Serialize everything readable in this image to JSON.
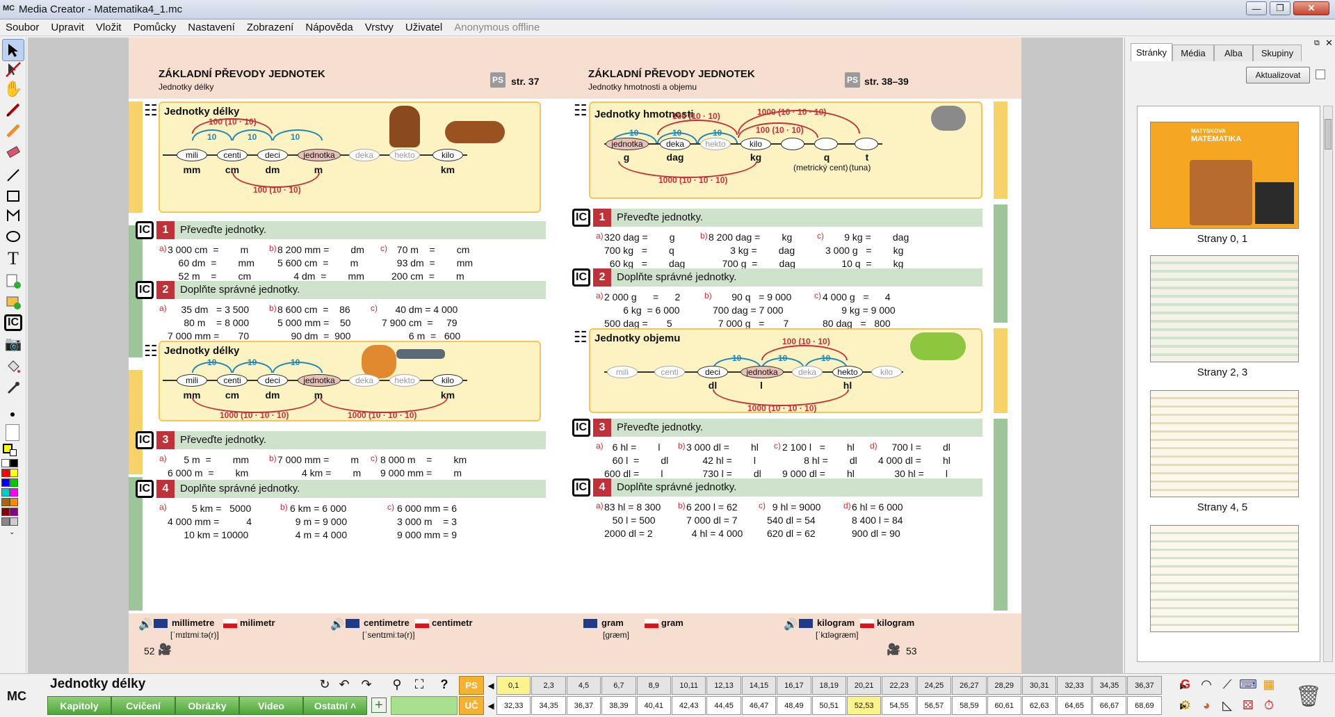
{
  "window": {
    "logo": "MC",
    "title": "Media Creator - Matematika4_1.mc",
    "minimize": "—",
    "maximize": "❐",
    "close": "✕"
  },
  "menu": [
    "Soubor",
    "Upravit",
    "Vložit",
    "Pomůcky",
    "Nastavení",
    "Zobrazení",
    "Nápověda",
    "Vrstvy",
    "Uživatel"
  ],
  "menu_status": "Anonymous offline",
  "left_page": {
    "title": "ZÁKLADNÍ PŘEVODY JEDNOTEK",
    "subtitle": "Jednotky délky",
    "ps": "PS",
    "str": "str. 37",
    "box1_title": "Jednotky délky",
    "box2_title": "Jednotky délky",
    "scale_nodes": [
      "mili",
      "centi",
      "deci",
      "jednotka",
      "deka",
      "hekto",
      "kilo"
    ],
    "scale_units": [
      "mm",
      "cm",
      "dm",
      "m",
      "km"
    ],
    "arc_10": "10",
    "arc_100": "100 (10 · 10)",
    "arc_1000": "1000 (10 · 10 · 10)",
    "ex1_title": "Převeďte jednotky.",
    "ex1_a": "3 000 cm  =        m\n    60 dm  =        mm\n    52 m    =        cm",
    "ex1_b": "8 200 mm =        dm\n5 600 cm  =        m\n      4 dm  =        mm",
    "ex1_c": "  70 m    =        cm\n  93 dm  =        mm\n200 cm  =        m",
    "ex2_title": "Doplňte správné jednotky.",
    "ex2_a": "     35 dm   = 3 500\n      80 m    = 8 000\n7 000 mm =       70",
    "ex2_b": "8 600 cm  =    86\n5 000 mm =    50\n     90 dm  =  900",
    "ex2_c": "     40 dm = 4 000\n7 900 cm  =     79\n          6 m  =   600",
    "ex3_title": "Převeďte jednotky.",
    "ex3_a": "      5 m  =        mm\n6 000 m  =        km",
    "ex3_b": "7 000 mm =        m\n         4 km =        m",
    "ex3_c": "8 000 m    =        km\n9 000 mm =        m",
    "ex4_title": "Doplňte správné jednotky.",
    "ex4_a": "         5 km =   5000\n4 000 mm =          4\n      10 km = 10000",
    "ex4_b": "6 km = 6 000\n  9 m = 9 000\n  4 m = 4 000",
    "ex4_c": "6 000 mm = 6\n3 000 m    = 3\n9 000 mm = 9",
    "foot_en": "millimetre",
    "foot_cz": "milimetr",
    "foot_ipa": "[ˈmɪlɪmiːtə(r)]",
    "foot_en2": "centimetre",
    "foot_cz2": "centimetr",
    "foot_ipa2": "[ˈsentɪmiːtə(r)]",
    "page_no": "52"
  },
  "right_page": {
    "title": "ZÁKLADNÍ PŘEVODY JEDNOTEK",
    "subtitle": "Jednotky hmotnosti a objemu",
    "ps": "PS",
    "str": "str. 38–39",
    "box1_title": "Jednotky hmotnosti",
    "mass_nodes": [
      "jednotka",
      "deka",
      "hekto",
      "kilo",
      "",
      "",
      ""
    ],
    "mass_units": [
      "g",
      "dag",
      "kg",
      "q",
      "t"
    ],
    "mass_notes": [
      "(metrický cent)",
      "(tuna)"
    ],
    "arc_10": "10",
    "arc_100": "100 (10 · 10)",
    "arc_1000": "1000 (10 · 10 · 10)",
    "box2_title": "Jednotky objemu",
    "vol_nodes": [
      "mili",
      "centi",
      "deci",
      "jednotka",
      "deka",
      "hekto",
      "kilo"
    ],
    "vol_units": [
      "dl",
      "l",
      "hl"
    ],
    "ex1_title": "Převeďte jednotky.",
    "ex1_a": "320 dag =        g\n700 kg   =        q\n  60 kg   =        dag",
    "ex1_b": "8 200 dag =        kg\n        3 kg =        dag\n     700 g  =        dag",
    "ex1_c": "       9 kg =        dag\n3 000 g   =        kg\n      10 q  =        kg",
    "ex2_title": "Doplňte správné jednotky.",
    "ex2_a": "2 000 g      =      2\n       6 kg  = 6 000\n500 dag =       5",
    "ex2_b": "       90 q   = 9 000\n700 dag = 7 000\n  7 000 g   =       7",
    "ex2_c": "4 000 g   =      4\n       9 kg = 9 000\n80 dag   =   800",
    "ex3_title": "Převeďte jednotky.",
    "ex3_a": "   6 hl =        l\n   60 l  =        dl\n600 dl =        l",
    "ex3_b": "3 000 dl =        hl\n      42 hl =        l\n      730 l =        dl",
    "ex3_c": "2 100 l   =        hl\n        8 hl =        dl\n9 000 dl =        hl",
    "ex3_d": "     700 l =        dl\n4 000 dl =        hl\n      30 hl =        l",
    "ex4_title": "Doplňte správné jednotky.",
    "ex4_a": "83 hl = 8 300\n   50 l = 500\n2000 dl = 2",
    "ex4_b": "6 200 l = 62\n7 000 dl = 7\n  4 hl = 4 000",
    "ex4_c": "  9 hl = 9000\n540 dl = 54\n620 dl = 62",
    "ex4_d": "6 hl = 6 000\n8 400 l = 84\n900 dl = 90",
    "foot_en": "gram",
    "foot_cz": "gram",
    "foot_ipa": "[græm]",
    "foot_en2": "kilogram",
    "foot_cz2": "kilogram",
    "foot_ipa2": "[ˈkɪləgræm]",
    "page_no": "53"
  },
  "ic_label": "IC",
  "exercise_numbers": [
    "1",
    "2",
    "3",
    "4"
  ],
  "exercise_letters": [
    "a)",
    "b)",
    "c)",
    "d)"
  ],
  "right_panel": {
    "tabs": [
      "Stránky",
      "Média",
      "Alba",
      "Skupiny"
    ],
    "refresh": "Aktualizovat",
    "thumbs": [
      "Strany 0, 1",
      "Strany 2, 3",
      "Strany 4, 5"
    ],
    "cover_brand": "MATYSKOVA",
    "cover_title": "MATEMATIKA"
  },
  "bottom": {
    "logo": "MC",
    "section_title": "Jednotky délky",
    "buttons": [
      "Kapitoly",
      "Cvičení",
      "Obrázky",
      "Video",
      "Ostatní ˄"
    ],
    "ps_label": "PS",
    "uc_label": "UČ",
    "ps_pages": [
      "0,1",
      "2,3",
      "4,5",
      "6,7",
      "8,9",
      "10,11",
      "12,13",
      "14,15",
      "16,17",
      "18,19",
      "20,21",
      "22,23",
      "24,25",
      "26,27",
      "28,29",
      "30,31",
      "32,33",
      "34,35",
      "36,37"
    ],
    "uc_pages": [
      "32,33",
      "34,35",
      "36,37",
      "38,39",
      "40,41",
      "42,43",
      "44,45",
      "46,47",
      "48,49",
      "50,51",
      "52,53",
      "54,55",
      "56,57",
      "58,59",
      "60,61",
      "62,63",
      "64,65",
      "66,67",
      "68,69"
    ]
  },
  "colors": {
    "accent_red": "#c0323a",
    "section_green": "#cfe3cc",
    "box_yellow": "#fdf3c2",
    "highlight": "#fbf48c",
    "ps_orange": "#f4b233"
  }
}
